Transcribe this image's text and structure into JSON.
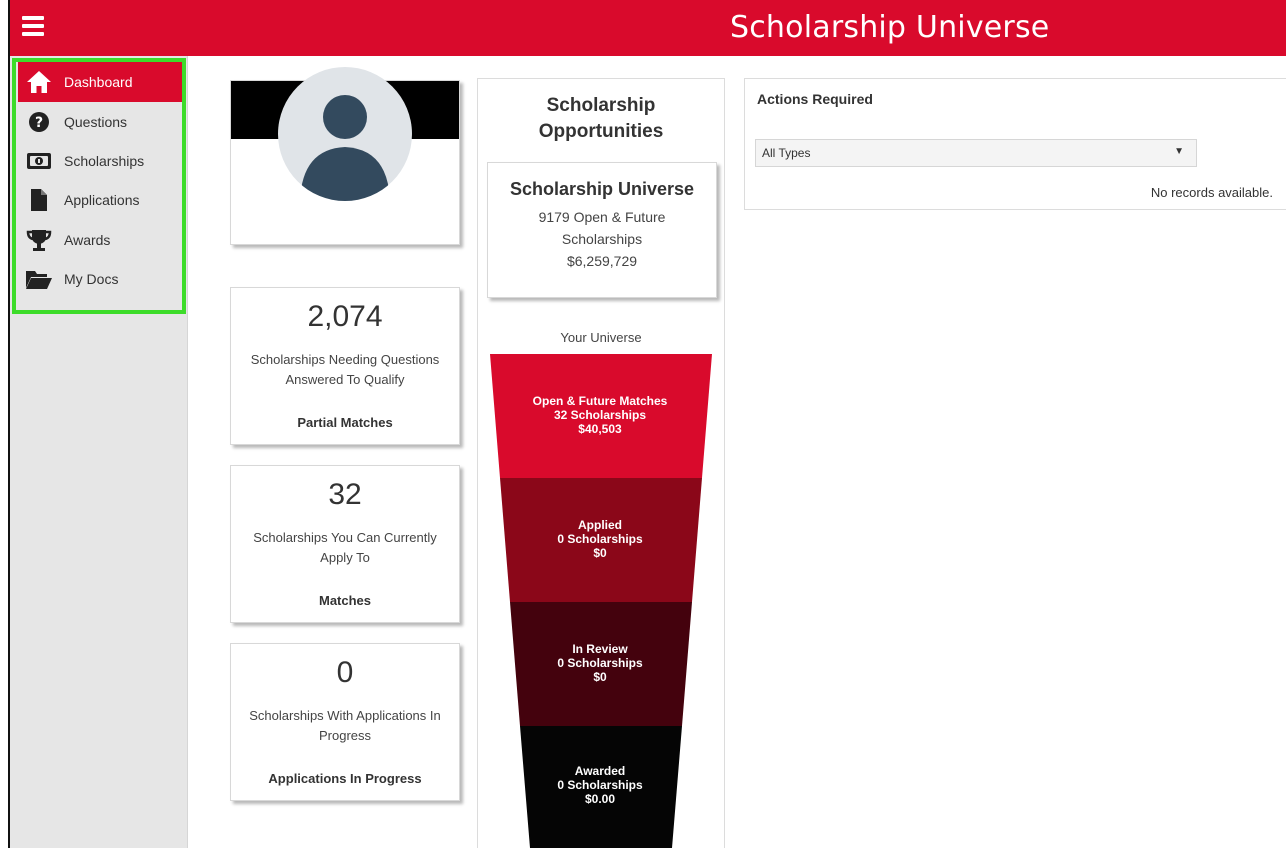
{
  "app": {
    "title": "Scholarship Universe"
  },
  "colors": {
    "brand_red": "#d90a2c",
    "nav_highlight": "#3ddc2a",
    "funnel": [
      "#d90a2c",
      "#8b0719",
      "#44020d",
      "#050505"
    ]
  },
  "sidebar": {
    "items": [
      {
        "label": "Dashboard",
        "icon": "home-icon",
        "active": true
      },
      {
        "label": "Questions",
        "icon": "question-circle-icon",
        "active": false
      },
      {
        "label": "Scholarships",
        "icon": "money-icon",
        "active": false
      },
      {
        "label": "Applications",
        "icon": "document-icon",
        "active": false
      },
      {
        "label": "Awards",
        "icon": "trophy-icon",
        "active": false
      },
      {
        "label": "My Docs",
        "icon": "folder-open-icon",
        "active": false
      }
    ]
  },
  "stats": [
    {
      "number": "2,074",
      "description": "Scholarships Needing Questions Answered To Qualify",
      "label": "Partial Matches"
    },
    {
      "number": "32",
      "description": "Scholarships You Can Currently Apply To",
      "label": "Matches"
    },
    {
      "number": "0",
      "description": "Scholarships With Applications In Progress",
      "label": "Applications In Progress"
    }
  ],
  "opportunities": {
    "title": "Scholarship Opportunities",
    "universe_card": {
      "title": "Scholarship Universe",
      "line1": "9179 Open & Future Scholarships",
      "amount": "$6,259,729"
    },
    "your_universe": "Your Universe",
    "funnel": [
      {
        "title": "Open & Future Matches",
        "count": "32 Scholarships",
        "amount": "$40,503"
      },
      {
        "title": "Applied",
        "count": "0 Scholarships",
        "amount": "$0"
      },
      {
        "title": "In Review",
        "count": "0 Scholarships",
        "amount": "$0"
      },
      {
        "title": "Awarded",
        "count": "0 Scholarships",
        "amount": "$0.00"
      }
    ]
  },
  "actions": {
    "title": "Actions Required",
    "select_value": "All Types",
    "empty_text": "No records available."
  }
}
